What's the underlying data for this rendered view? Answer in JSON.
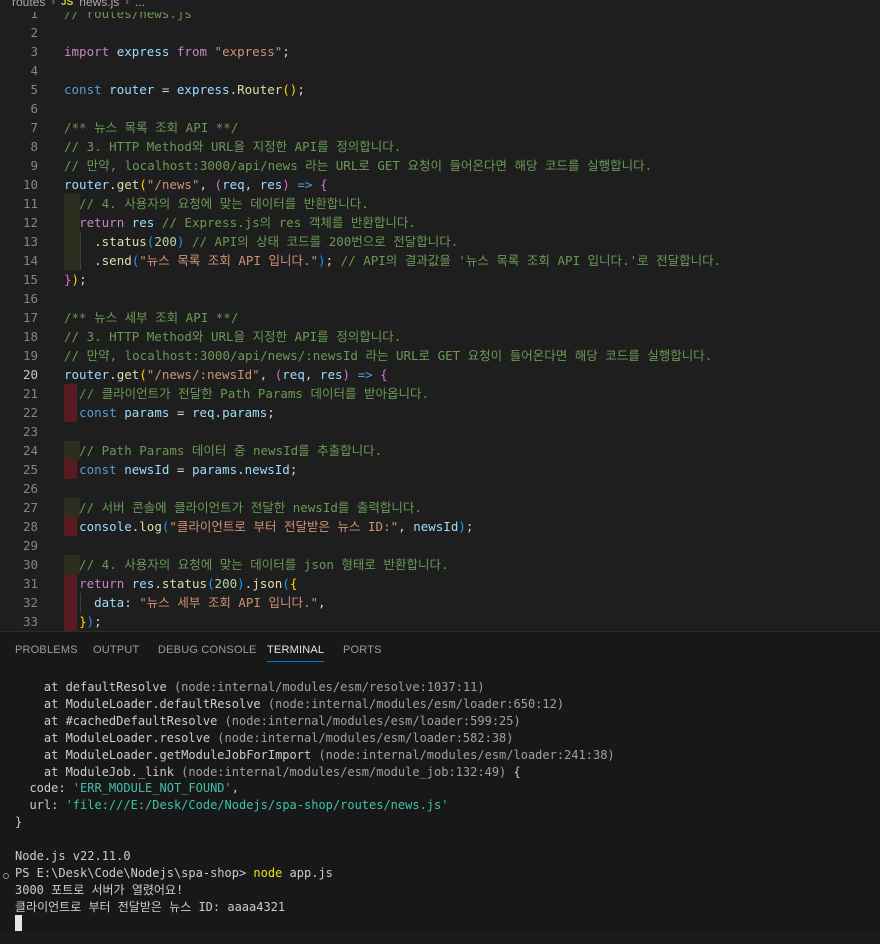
{
  "breadcrumb": {
    "folder": "routes",
    "file_badge": "JS",
    "file": "news.js",
    "more": "..."
  },
  "editor": {
    "lines": [
      {
        "n": "1",
        "tokens": [
          [
            "// routes/news.js",
            "comment"
          ]
        ]
      },
      {
        "n": "2",
        "tokens": []
      },
      {
        "n": "3",
        "tokens": [
          [
            "import",
            "ctl"
          ],
          [
            " ",
            "plain"
          ],
          [
            "express",
            "var"
          ],
          [
            " ",
            "plain"
          ],
          [
            "from",
            "ctl"
          ],
          [
            " ",
            "plain"
          ],
          [
            "\"express\"",
            "str"
          ],
          [
            ";",
            "plain"
          ]
        ]
      },
      {
        "n": "4",
        "tokens": []
      },
      {
        "n": "5",
        "tokens": [
          [
            "const",
            "kw"
          ],
          [
            " ",
            "plain"
          ],
          [
            "router",
            "var"
          ],
          [
            " = ",
            "plain"
          ],
          [
            "express",
            "var"
          ],
          [
            ".",
            "plain"
          ],
          [
            "Router",
            "fn"
          ],
          [
            "()",
            "b1"
          ],
          [
            ";",
            "plain"
          ]
        ]
      },
      {
        "n": "6",
        "tokens": []
      },
      {
        "n": "7",
        "tokens": [
          [
            "/** 뉴스 목록 조회 API **/",
            "comment"
          ]
        ]
      },
      {
        "n": "8",
        "tokens": [
          [
            "// 3. HTTP Method와 URL을 지정한 API를 정의합니다.",
            "comment"
          ]
        ]
      },
      {
        "n": "9",
        "tokens": [
          [
            "// 만약, localhost:3000/api/news 라는 URL로 GET 요청이 들어온다면 해당 코드를 실행합니다.",
            "comment"
          ]
        ]
      },
      {
        "n": "10",
        "tokens": [
          [
            "router",
            "var"
          ],
          [
            ".",
            "plain"
          ],
          [
            "get",
            "fn"
          ],
          [
            "(",
            "b1"
          ],
          [
            "\"/news\"",
            "str"
          ],
          [
            ", ",
            "plain"
          ],
          [
            "(",
            "b2"
          ],
          [
            "req",
            "var"
          ],
          [
            ", ",
            "plain"
          ],
          [
            "res",
            "var"
          ],
          [
            ")",
            "b2"
          ],
          [
            " ",
            "plain"
          ],
          [
            "=>",
            "kw"
          ],
          [
            " ",
            "plain"
          ],
          [
            "{",
            "b2"
          ]
        ],
        "guides": 0
      },
      {
        "n": "11",
        "tokens": [
          [
            "  // 4. 사용자의 요청에 맞는 데이터를 반환합니다.",
            "comment"
          ]
        ],
        "guides": 1,
        "hl": "y"
      },
      {
        "n": "12",
        "tokens": [
          [
            "  ",
            "plain"
          ],
          [
            "return",
            "ctl"
          ],
          [
            " ",
            "plain"
          ],
          [
            "res",
            "var"
          ],
          [
            " // Express.js의 res 객체를 반환합니다.",
            "comment"
          ]
        ],
        "guides": 1,
        "hl": "y"
      },
      {
        "n": "13",
        "tokens": [
          [
            "    .",
            "plain"
          ],
          [
            "status",
            "fn"
          ],
          [
            "(",
            "b3"
          ],
          [
            "200",
            "num"
          ],
          [
            ")",
            "b3"
          ],
          [
            " // API의 상태 코드를 200번으로 전달합니다.",
            "comment"
          ]
        ],
        "guides": 2,
        "hl": "y"
      },
      {
        "n": "14",
        "tokens": [
          [
            "    .",
            "plain"
          ],
          [
            "send",
            "fn"
          ],
          [
            "(",
            "b3"
          ],
          [
            "\"뉴스 목록 조회 API 입니다.\"",
            "str"
          ],
          [
            ")",
            "b3"
          ],
          [
            ";",
            "plain"
          ],
          [
            " // API의 결과값을 '뉴스 목록 조회 API 입니다.'로 전달합니다.",
            "comment"
          ]
        ],
        "guides": 2,
        "hl": "y"
      },
      {
        "n": "15",
        "tokens": [
          [
            "}",
            "b2"
          ],
          [
            ")",
            "b1"
          ],
          [
            ";",
            "plain"
          ]
        ]
      },
      {
        "n": "16",
        "tokens": []
      },
      {
        "n": "17",
        "tokens": [
          [
            "/** 뉴스 세부 조회 API **/",
            "comment"
          ]
        ]
      },
      {
        "n": "18",
        "tokens": [
          [
            "// 3. HTTP Method와 URL을 지정한 API를 정의합니다.",
            "comment"
          ]
        ]
      },
      {
        "n": "19",
        "tokens": [
          [
            "// 만약, localhost:3000/api/news/:newsId 라는 URL로 GET 요청이 들어온다면 해당 코드를 실행합니다.",
            "comment"
          ]
        ]
      },
      {
        "n": "20",
        "tokens": [
          [
            "router",
            "var"
          ],
          [
            ".",
            "plain"
          ],
          [
            "get",
            "fn"
          ],
          [
            "(",
            "b1"
          ],
          [
            "\"/news/:newsId\"",
            "str"
          ],
          [
            ", ",
            "plain"
          ],
          [
            "(",
            "b2"
          ],
          [
            "req",
            "var"
          ],
          [
            ", ",
            "plain"
          ],
          [
            "res",
            "var"
          ],
          [
            ")",
            "b2"
          ],
          [
            " ",
            "plain"
          ],
          [
            "=>",
            "kw"
          ],
          [
            " ",
            "plain"
          ],
          [
            "{",
            "b2"
          ]
        ],
        "active": true
      },
      {
        "n": "21",
        "tokens": [
          [
            "  // 클라이언트가 전달한 Path Params 데이터를 받아옵니다.",
            "comment"
          ]
        ],
        "guides": 1,
        "hl": "r"
      },
      {
        "n": "22",
        "tokens": [
          [
            "  ",
            "plain"
          ],
          [
            "const",
            "kw"
          ],
          [
            " ",
            "plain"
          ],
          [
            "params",
            "var"
          ],
          [
            " = ",
            "plain"
          ],
          [
            "req",
            "var"
          ],
          [
            ".",
            "plain"
          ],
          [
            "params",
            "var"
          ],
          [
            ";",
            "plain"
          ]
        ],
        "guides": 1,
        "hl": "r"
      },
      {
        "n": "23",
        "tokens": [],
        "guides": 1
      },
      {
        "n": "24",
        "tokens": [
          [
            "  // Path Params 데이터 중 newsId를 추출합니다.",
            "comment"
          ]
        ],
        "guides": 1,
        "hl": "y"
      },
      {
        "n": "25",
        "tokens": [
          [
            "  ",
            "plain"
          ],
          [
            "const",
            "kw"
          ],
          [
            " ",
            "plain"
          ],
          [
            "newsId",
            "var"
          ],
          [
            " = ",
            "plain"
          ],
          [
            "params",
            "var"
          ],
          [
            ".",
            "plain"
          ],
          [
            "newsId",
            "var"
          ],
          [
            ";",
            "plain"
          ]
        ],
        "guides": 1,
        "hl": "r"
      },
      {
        "n": "26",
        "tokens": [],
        "guides": 1
      },
      {
        "n": "27",
        "tokens": [
          [
            "  // 서버 콘솔에 클라이언트가 전달한 newsId를 출력합니다.",
            "comment"
          ]
        ],
        "guides": 1,
        "hl": "y"
      },
      {
        "n": "28",
        "tokens": [
          [
            "  ",
            "plain"
          ],
          [
            "console",
            "var"
          ],
          [
            ".",
            "plain"
          ],
          [
            "log",
            "fn"
          ],
          [
            "(",
            "b3"
          ],
          [
            "\"클라이언트로 부터 전달받은 뉴스 ID:\"",
            "str"
          ],
          [
            ", ",
            "plain"
          ],
          [
            "newsId",
            "var"
          ],
          [
            ")",
            "b3"
          ],
          [
            ";",
            "plain"
          ]
        ],
        "guides": 1,
        "hl": "r"
      },
      {
        "n": "29",
        "tokens": [],
        "guides": 1
      },
      {
        "n": "30",
        "tokens": [
          [
            "  // 4. 사용자의 요청에 맞는 데이터를 json 형태로 반환합니다.",
            "comment"
          ]
        ],
        "guides": 1,
        "hl": "y"
      },
      {
        "n": "31",
        "tokens": [
          [
            "  ",
            "plain"
          ],
          [
            "return",
            "ctl"
          ],
          [
            " ",
            "plain"
          ],
          [
            "res",
            "var"
          ],
          [
            ".",
            "plain"
          ],
          [
            "status",
            "fn"
          ],
          [
            "(",
            "b3"
          ],
          [
            "200",
            "num"
          ],
          [
            ")",
            "b3"
          ],
          [
            ".",
            "plain"
          ],
          [
            "json",
            "fn"
          ],
          [
            "(",
            "b3"
          ],
          [
            "{",
            "b1"
          ]
        ],
        "guides": 1,
        "hl": "r"
      },
      {
        "n": "32",
        "tokens": [
          [
            "    ",
            "plain"
          ],
          [
            "data",
            "var"
          ],
          [
            ": ",
            "plain"
          ],
          [
            "\"뉴스 세부 조회 API 입니다.\"",
            "str"
          ],
          [
            ",",
            "plain"
          ]
        ],
        "guides": 2,
        "hl": "r"
      },
      {
        "n": "33",
        "tokens": [
          [
            "  ",
            "plain"
          ],
          [
            "}",
            "b1"
          ],
          [
            ")",
            "b3"
          ],
          [
            ";",
            "plain"
          ]
        ],
        "guides": 1,
        "hl": "r"
      }
    ]
  },
  "panel": {
    "tabs": [
      {
        "id": "problems",
        "label": "PROBLEMS"
      },
      {
        "id": "output",
        "label": "OUTPUT"
      },
      {
        "id": "debug",
        "label": "DEBUG CONSOLE"
      },
      {
        "id": "terminal",
        "label": "TERMINAL",
        "active": true
      },
      {
        "id": "ports",
        "label": "PORTS"
      }
    ],
    "terminal_lines": [
      [
        [
          "    at defaultResolve ",
          "plain"
        ],
        [
          "(node:internal/modules/esm/resolve:1037:11)",
          "gray"
        ]
      ],
      [
        [
          "    at ModuleLoader.defaultResolve ",
          "plain"
        ],
        [
          "(node:internal/modules/esm/loader:650:12)",
          "gray"
        ]
      ],
      [
        [
          "    at #cachedDefaultResolve ",
          "plain"
        ],
        [
          "(node:internal/modules/esm/loader:599:25)",
          "gray"
        ]
      ],
      [
        [
          "    at ModuleLoader.resolve ",
          "plain"
        ],
        [
          "(node:internal/modules/esm/loader:582:38)",
          "gray"
        ]
      ],
      [
        [
          "    at ModuleLoader.getModuleJobForImport ",
          "plain"
        ],
        [
          "(node:internal/modules/esm/loader:241:38)",
          "gray"
        ]
      ],
      [
        [
          "    at ModuleJob._link ",
          "plain"
        ],
        [
          "(node:internal/modules/esm/module_job:132:49)",
          "gray"
        ],
        [
          " {",
          "plain"
        ]
      ],
      [
        [
          "  code: ",
          "plain"
        ],
        [
          "'ERR_MODULE_NOT_FOUND'",
          "str"
        ],
        [
          ",",
          "plain"
        ]
      ],
      [
        [
          "  url: ",
          "plain"
        ],
        [
          "'file:///E:/Desk/Code/Nodejs/spa-shop/routes/news.js'",
          "str"
        ]
      ],
      [
        [
          "}",
          "plain"
        ]
      ],
      [],
      [
        [
          "Node.js v22.11.0",
          "plain"
        ]
      ],
      [
        [
          "PS E:\\Desk\\Code\\Nodejs\\spa-shop> ",
          "plain"
        ],
        [
          "node",
          "cmd"
        ],
        [
          " app.js",
          "plain"
        ]
      ],
      [
        [
          "3000 포트로 서버가 열렸어요!",
          "plain"
        ]
      ],
      [
        [
          "클라이언트로 부터 전달받은 뉴스 ID: aaaa4321",
          "plain"
        ]
      ]
    ]
  }
}
